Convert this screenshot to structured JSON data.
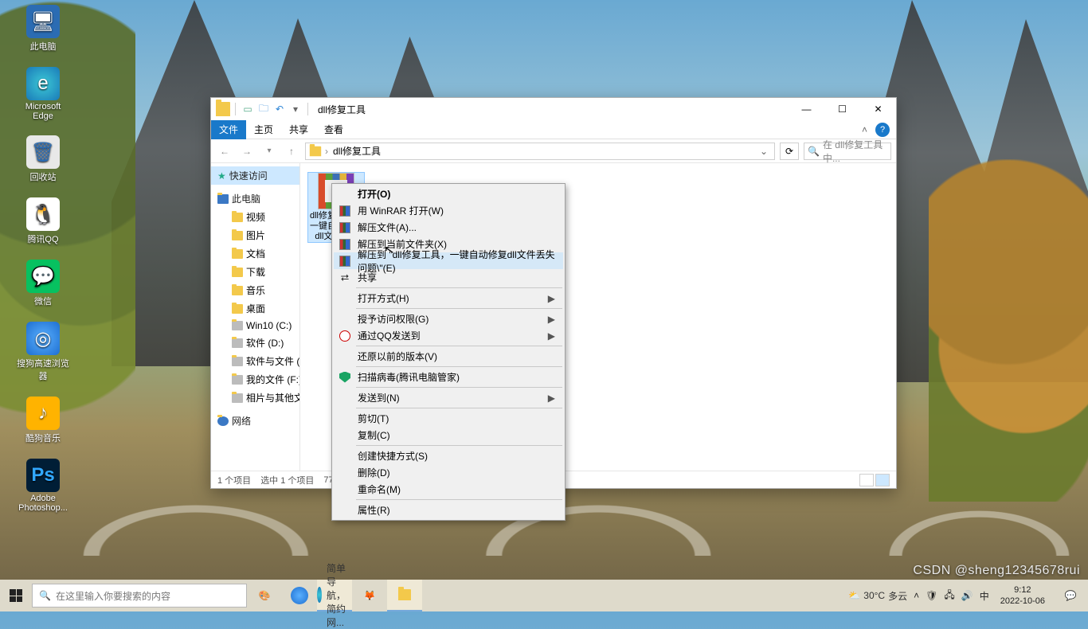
{
  "desktop": {
    "icons": [
      {
        "label": "此电脑",
        "cls": "pc",
        "glyph": "🖥"
      },
      {
        "label": "Microsoft Edge",
        "cls": "edge",
        "glyph": "e"
      },
      {
        "label": "回收站",
        "cls": "recycle",
        "glyph": "🗑"
      },
      {
        "label": "腾讯QQ",
        "cls": "qq",
        "glyph": "🐧"
      },
      {
        "label": "微信",
        "cls": "wechat",
        "glyph": "💬"
      },
      {
        "label": "搜狗高速浏览器",
        "cls": "sogou",
        "glyph": "◎"
      },
      {
        "label": "酷狗音乐",
        "cls": "kwai",
        "glyph": "♪"
      },
      {
        "label": "Adobe Photoshop...",
        "cls": "ps",
        "glyph": "Ps"
      }
    ]
  },
  "explorer": {
    "title": "dll修复工具",
    "ribbon": {
      "file": "文件",
      "home": "主页",
      "share": "共享",
      "view": "查看"
    },
    "search_placeholder": "在 dll修复工具 中...",
    "breadcrumb": [
      "›",
      "dll修复工具"
    ],
    "nav": {
      "quick": "快速访问",
      "thispc": "此电脑",
      "items": [
        "视频",
        "图片",
        "文档",
        "下载",
        "音乐",
        "桌面",
        "Win10 (C:)",
        "软件 (D:)",
        "软件与文件 (E:)",
        "我的文件 (F:)",
        "相片与其他文件 (G:)"
      ],
      "network": "网络"
    },
    "file": {
      "name": "dll修复工具，一键自动修复dll文件丢..."
    },
    "status": {
      "count": "1 个项目",
      "selected": "选中 1 个项目",
      "size": "77.9 MB"
    }
  },
  "context": {
    "open": "打开(O)",
    "winrar_open": "用 WinRAR 打开(W)",
    "extract_files": "解压文件(A)...",
    "extract_here": "解压到当前文件夹(X)",
    "extract_to": "解压到 \"dll修复工具，一键自动修复dll文件丢失问题\\\"(E)",
    "share": "共享",
    "open_with": "打开方式(H)",
    "grant_access": "授予访问权限(G)",
    "qq_send": "通过QQ发送到",
    "restore_prev": "还原以前的版本(V)",
    "scan": "扫描病毒(腾讯电脑管家)",
    "send_to": "发送到(N)",
    "cut": "剪切(T)",
    "copy": "复制(C)",
    "shortcut": "创建快捷方式(S)",
    "delete": "删除(D)",
    "rename": "重命名(M)",
    "properties": "属性(R)"
  },
  "taskbar": {
    "search_placeholder": "在这里输入你要搜索的内容",
    "browser_tab": "简单导航，简约网...",
    "weather": {
      "temp": "30°C",
      "cond": "多云"
    },
    "time": "9:12",
    "date": "2022-10-06"
  },
  "watermark": "CSDN @sheng12345678rui"
}
